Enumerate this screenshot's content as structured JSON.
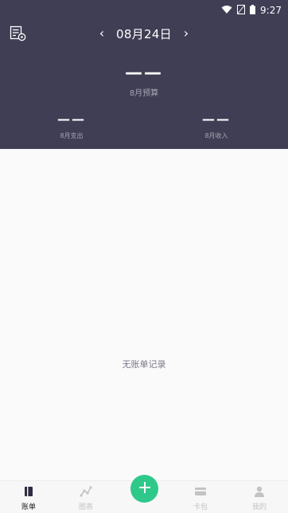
{
  "status_bar": {
    "time": "9:27"
  },
  "header": {
    "date": "08月24日",
    "prev_arrow": "‹",
    "next_arrow": "›",
    "budget_value": "——",
    "budget_label": "8月预算",
    "expense_value": "——",
    "expense_label": "8月支出",
    "income_value": "——",
    "income_label": "8月收入"
  },
  "main": {
    "empty_text": "无账单记录"
  },
  "tabbar": {
    "tabs": [
      {
        "label": "账单",
        "icon": "book-icon",
        "active": true
      },
      {
        "label": "图表",
        "icon": "chart-icon",
        "active": false
      },
      {
        "label": "卡包",
        "icon": "card-icon",
        "active": false
      },
      {
        "label": "我的",
        "icon": "user-icon",
        "active": false
      }
    ],
    "add_icon": "plus-icon"
  },
  "colors": {
    "header_bg": "#403e54",
    "accent": "#2ec98a",
    "muted_text": "#a6a5b4"
  }
}
